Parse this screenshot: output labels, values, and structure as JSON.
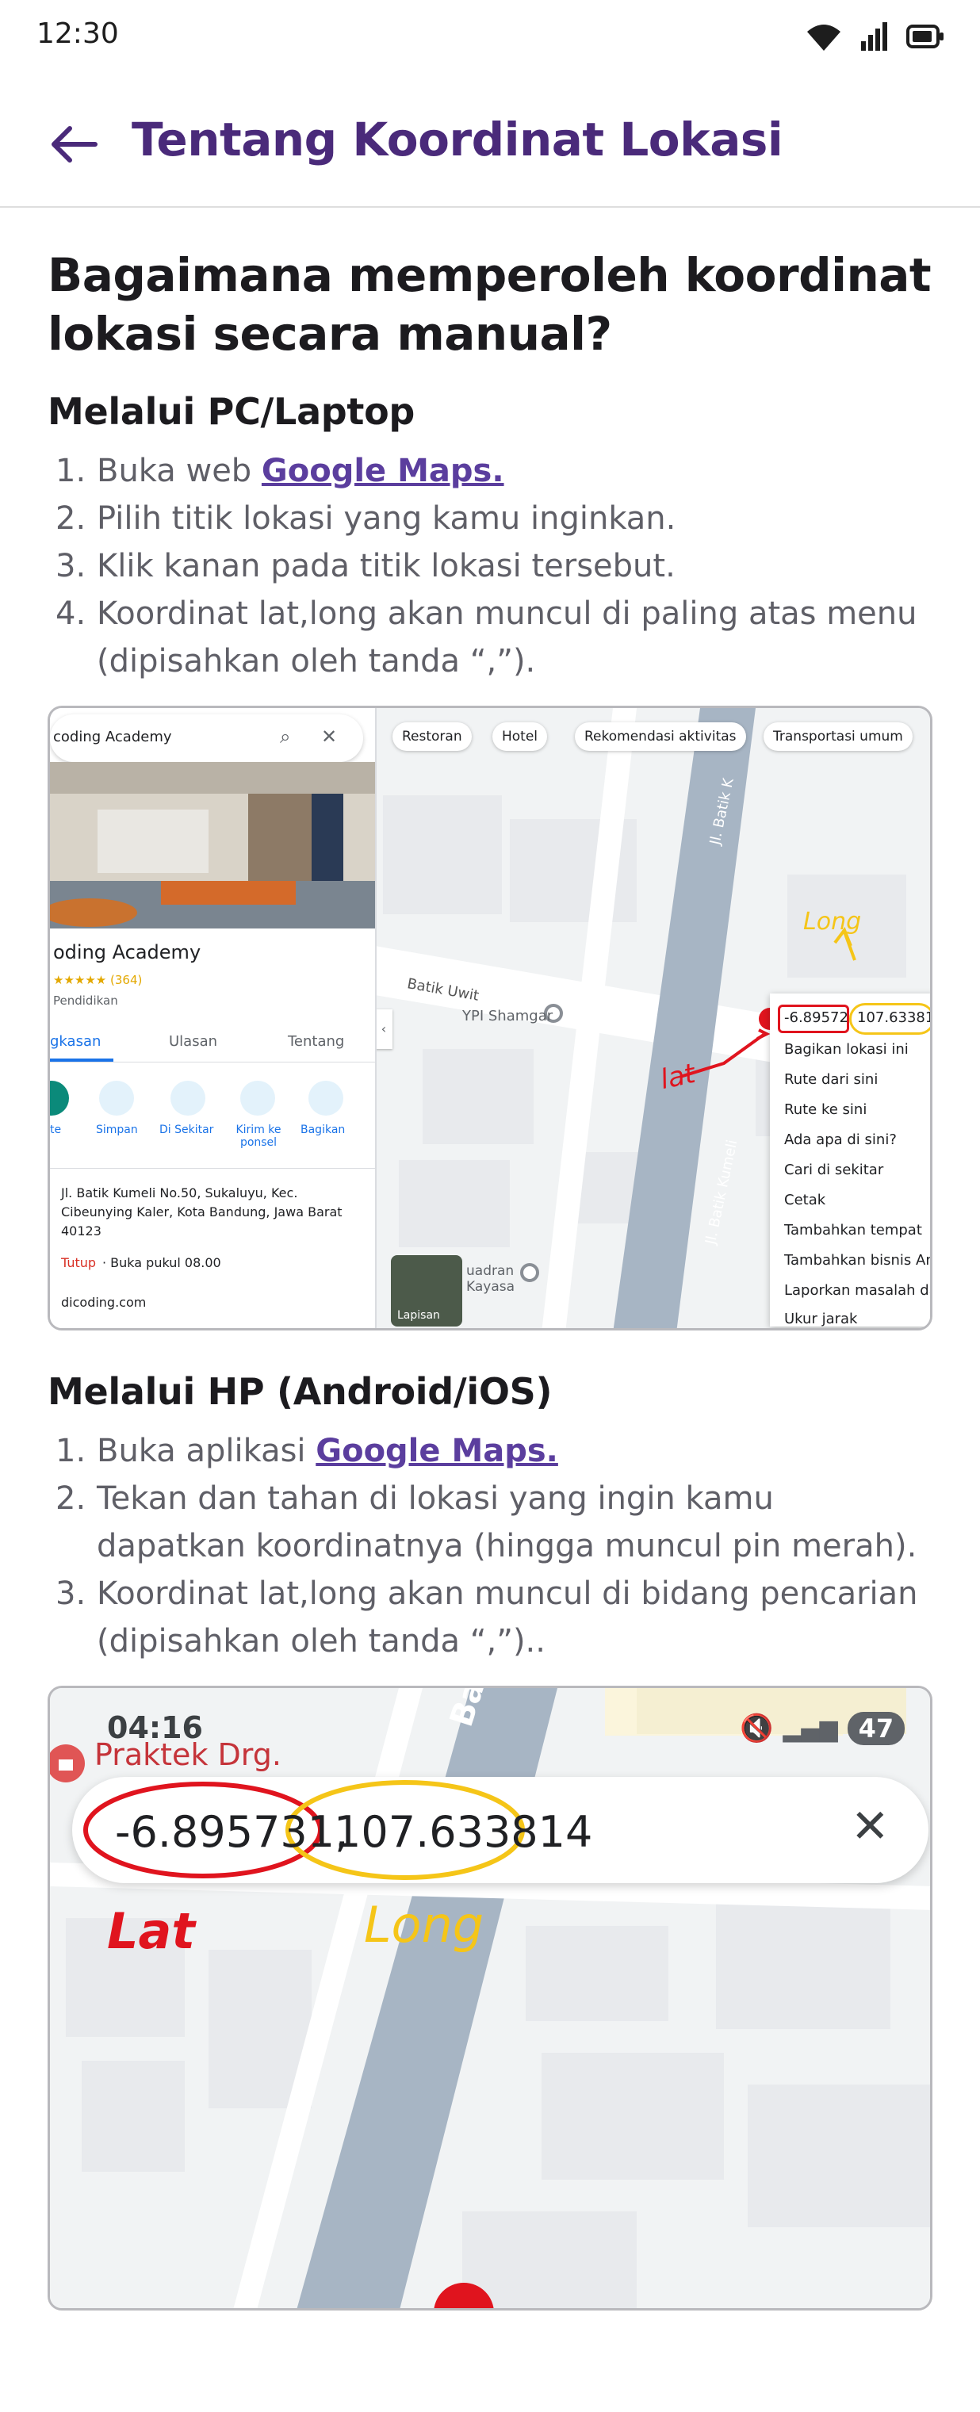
{
  "status": {
    "time": "12:30",
    "icons": [
      "wifi-icon",
      "signal-icon",
      "battery-icon"
    ]
  },
  "app_bar": {
    "title": "Tentang Koordinat Lokasi",
    "back_icon": "arrow-back-icon"
  },
  "main_question": "Bagaimana memperoleh koordinat lokasi secara manual?",
  "pc_section": {
    "heading": "Melalui PC/Laptop",
    "steps": [
      {
        "num": "1.",
        "pre": "Buka web ",
        "link": "Google Maps.",
        "text": ""
      },
      {
        "num": "2.",
        "text": "Pilih titik lokasi yang kamu inginkan."
      },
      {
        "num": "3.",
        "text": "Klik kanan pada titik lokasi tersebut."
      },
      {
        "num": "4.",
        "text": "Koordinat lat,long akan muncul di paling atas menu (dipisahkan oleh tanda “,”)."
      }
    ],
    "screenshot": {
      "search_text": "coding Academy",
      "place_name": "oding Academy",
      "rating": "★★★★★ (364)",
      "category": "Pendidikan",
      "tabs": [
        "gkasan",
        "Ulasan",
        "Tentang"
      ],
      "actions": [
        "te",
        "Simpan",
        "Di Sekitar",
        "Kirim ke ponsel",
        "Bagikan"
      ],
      "address": "Jl. Batik Kumeli No.50, Sukaluyu, Kec. Cibeunying Kaler, Kota Bandung, Jawa Barat 40123",
      "hours_status": "Tutup",
      "hours_text": "· Buka pukul 08.00",
      "website": "dicoding.com",
      "chips": [
        "Restoran",
        "Hotel",
        "Rekomendasi aktivitas",
        "Transportasi umum"
      ],
      "street_1": "Batik Uwit",
      "street_2": "Jl. Batik Kumeli",
      "street_3": "Jl. Batik K",
      "place_1": "YPI Shamgar",
      "place_2": "uadran Kayasa",
      "layer_label": "Lapisan",
      "lat_value": "-6.89572",
      "long_value": "107.63381",
      "lat_annotation": "lat",
      "long_annotation": "Long",
      "menu_items": [
        "Bagikan lokasi ini",
        "Rute dari sini",
        "Rute ke sini",
        "Ada apa di sini?",
        "Cari di sekitar",
        "Cetak",
        "Tambahkan tempat",
        "Tambahkan bisnis And",
        "Laporkan masalah da",
        "Ukur jarak"
      ]
    }
  },
  "hp_section": {
    "heading": "Melalui HP (Android/iOS)",
    "steps": [
      {
        "num": "1.",
        "pre": "Buka aplikasi ",
        "link": "Google Maps.",
        "text": ""
      },
      {
        "num": "2.",
        "text": "Tekan dan tahan di lokasi yang ingin kamu dapatkan koordinatnya (hingga muncul pin merah)."
      },
      {
        "num": "3.",
        "text": "Koordinat lat,long akan muncul di bidang pencarian (dipisahkan oleh tanda “,”).."
      }
    ],
    "screenshot": {
      "time": "04:16",
      "badge": "47",
      "place_label": "Praktek Drg.",
      "street_label": "Batik",
      "lat_value": "-6.895731,",
      "long_value": "107.633814",
      "lat_annotation": "Lat",
      "long_annotation": "Long"
    }
  },
  "colors": {
    "title": "#4a2a7a",
    "link": "#5b3e9e",
    "annotation_red": "#e0141e",
    "annotation_yellow": "#f5c518"
  }
}
